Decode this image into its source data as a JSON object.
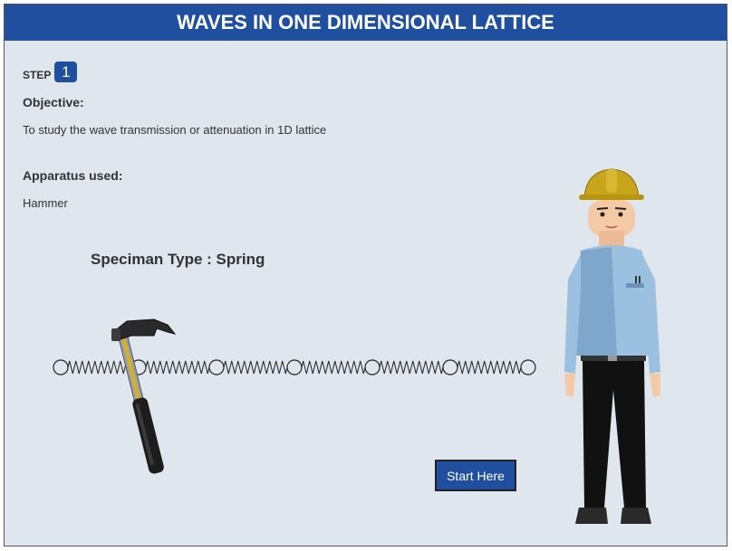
{
  "header": {
    "title": "WAVES IN ONE DIMENSIONAL LATTICE"
  },
  "step": {
    "label": "STEP",
    "number": "1"
  },
  "objective": {
    "heading": "Objective:",
    "text": "To study the wave transmission or attenuation in 1D lattice"
  },
  "apparatus": {
    "heading": "Apparatus used:",
    "text": "Hammer"
  },
  "specimen": {
    "label": "Speciman Type : Spring"
  },
  "actions": {
    "start_label": "Start Here"
  },
  "colors": {
    "accent": "#1f4f9e",
    "background": "#dfe6ed",
    "helmet": "#c9a51c",
    "shirt": "#9cc0e0",
    "trousers": "#111111"
  },
  "icons": [
    "hammer-icon",
    "spring-lattice",
    "worker-figure"
  ]
}
